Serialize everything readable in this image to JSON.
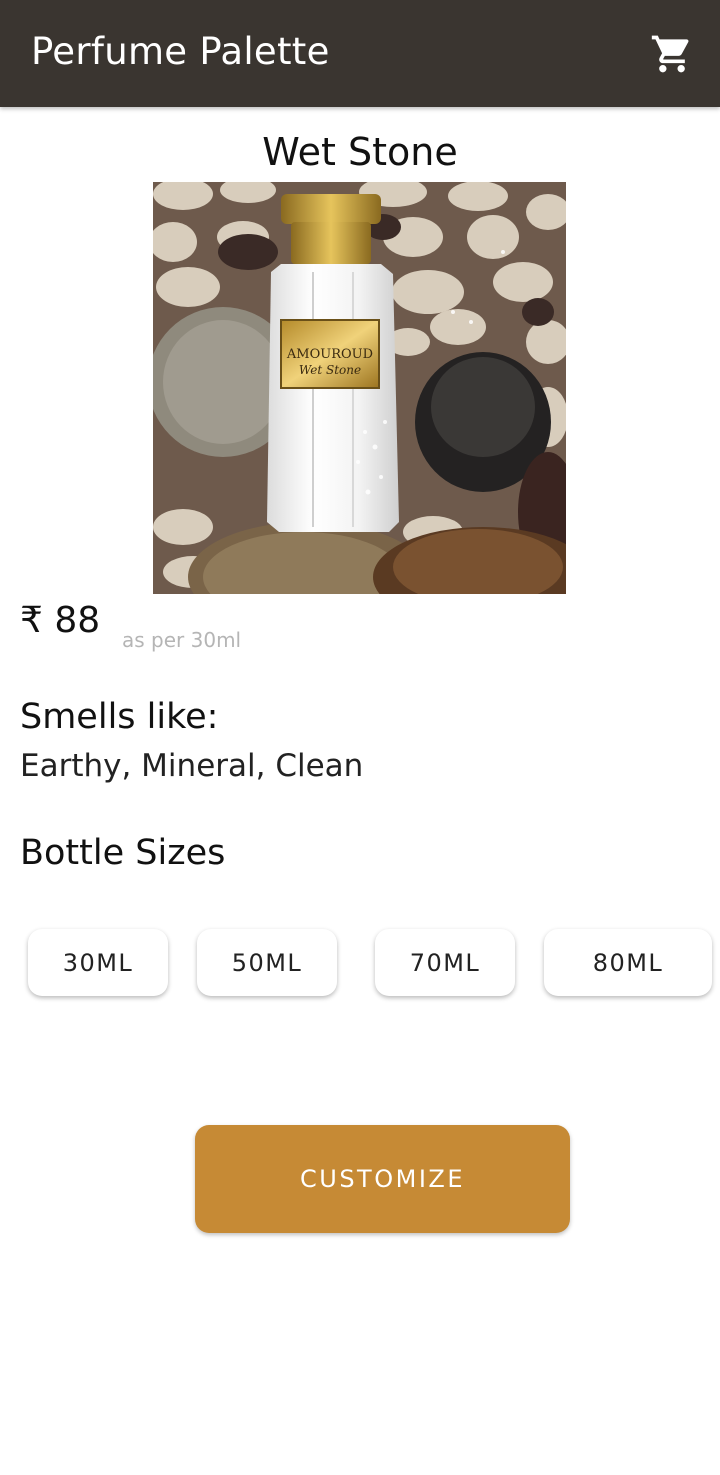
{
  "app": {
    "title": "Perfume Palette",
    "cart_icon": "shopping-cart-icon"
  },
  "product": {
    "name": "Wet Stone",
    "image_label_brand": "AMOUROUD",
    "image_label_name": "Wet Stone",
    "price": "₹ 88",
    "price_note": "as per 30ml",
    "smells_heading": "Smells like:",
    "smells_value": "Earthy, Mineral, Clean",
    "sizes_heading": "Bottle Sizes",
    "sizes": [
      "30ML",
      "50ML",
      "70ML",
      "80ML"
    ]
  },
  "actions": {
    "customize_label": "CUSTOMIZE"
  },
  "colors": {
    "appbar_bg": "#3a3530",
    "accent": "#c68a35"
  }
}
